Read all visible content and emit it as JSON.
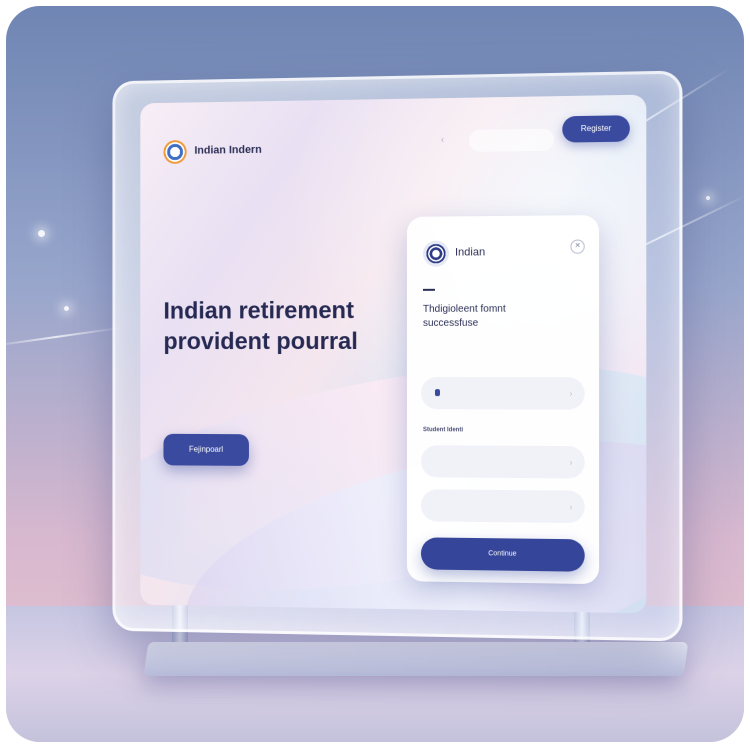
{
  "header": {
    "brand_name": "Indian Indern",
    "brand_tagline": "",
    "search_placeholder": "",
    "cta_label": "Register"
  },
  "hero": {
    "eyebrow": "",
    "title_line1": "Indian retirement",
    "title_line2": "provident pourral",
    "description": "",
    "button_label": "Fejinpoarl"
  },
  "card": {
    "brand_name": "Indian",
    "title": "Thdigioleent fomnt successfuse",
    "hint": "",
    "field1_placeholder": "",
    "section_label": "Student Identi",
    "field2_placeholder": "",
    "field3_placeholder": "",
    "submit_label": "Continue"
  },
  "icons": {
    "brand_logo": "chakra-emblem-icon",
    "card_logo": "ashoka-chakra-icon",
    "close": "close-icon",
    "chevron": "chevron-right-icon"
  },
  "colors": {
    "accent": "#3a4a9e",
    "title": "#262a52",
    "card_background": "#ffffff"
  }
}
